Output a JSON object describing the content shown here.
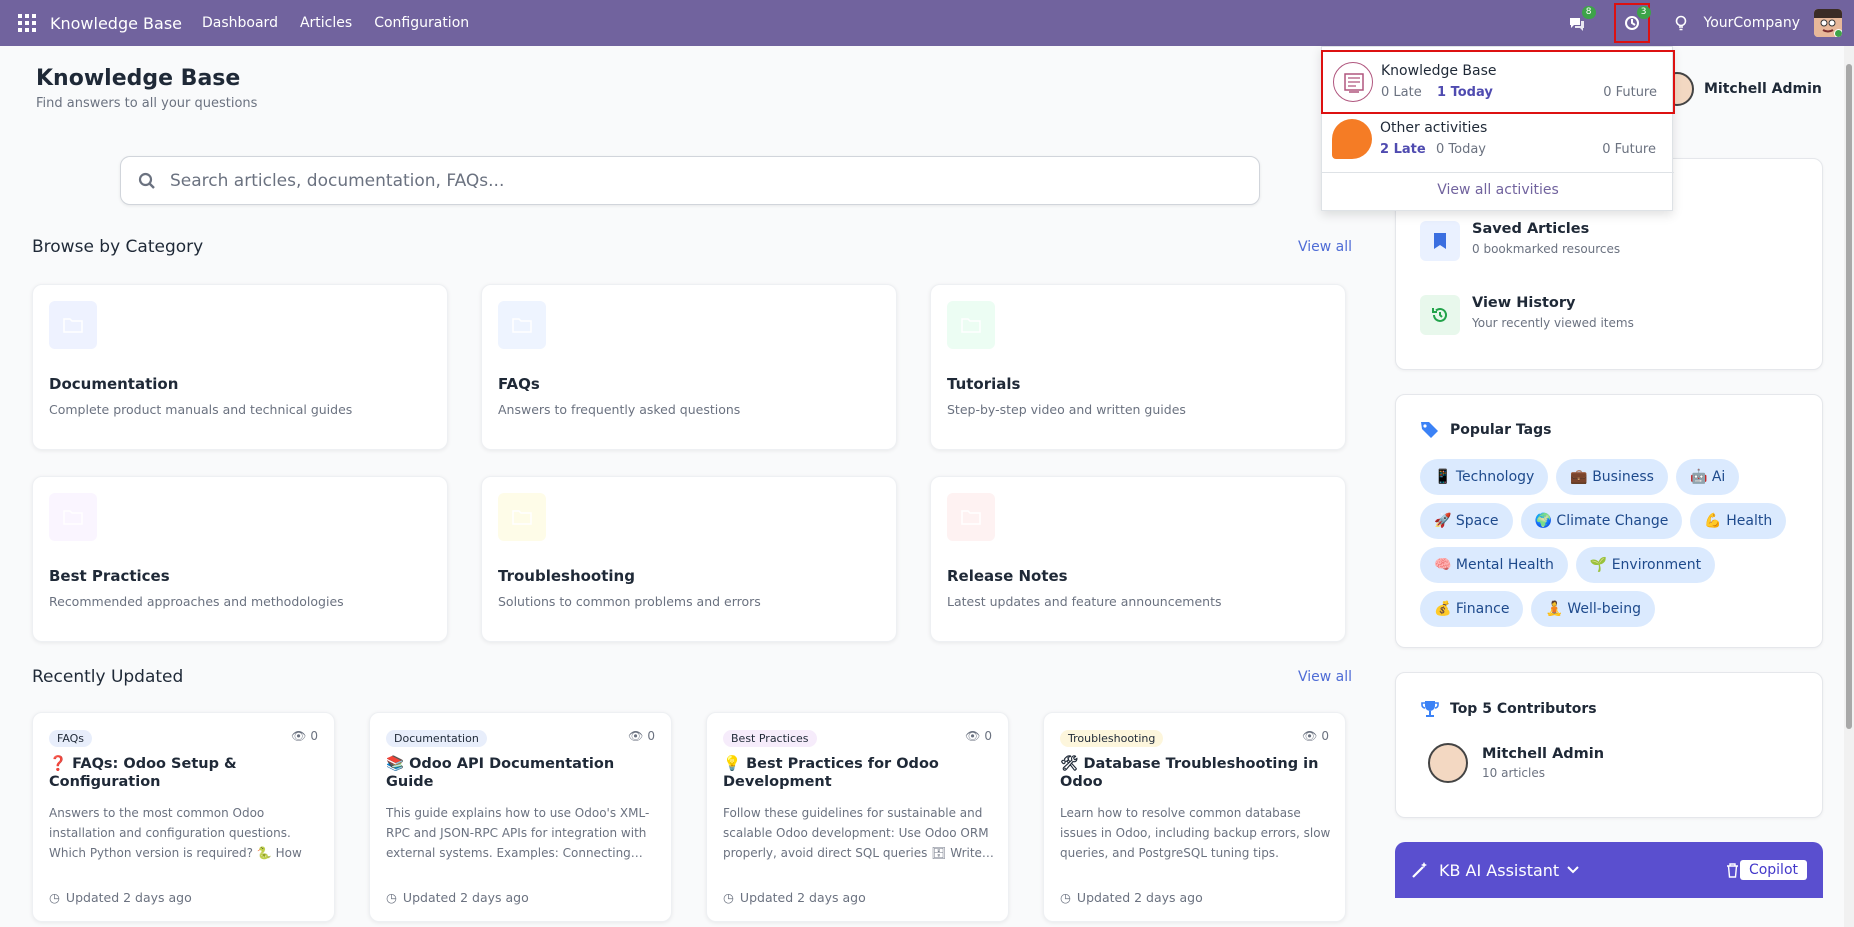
{
  "navbar": {
    "brand": "Knowledge Base",
    "menu": [
      "Dashboard",
      "Articles",
      "Configuration"
    ],
    "chat_badge": "8",
    "activity_badge": "3",
    "company": "YourCompany"
  },
  "header": {
    "title": "Knowledge Base",
    "subtitle": "Find answers to all your questions",
    "user_name": "Mitchell Admin"
  },
  "search": {
    "placeholder": "Search articles, documentation, FAQs..."
  },
  "categories": {
    "title": "Browse by Category",
    "view_all": "View all",
    "items": [
      {
        "name": "Documentation",
        "desc": "Complete product manuals and technical guides",
        "color": "#eef2ff"
      },
      {
        "name": "FAQs",
        "desc": "Answers to frequently asked questions",
        "color": "#eef4ff"
      },
      {
        "name": "Tutorials",
        "desc": "Step-by-step video and written guides",
        "color": "#ecfdf3"
      },
      {
        "name": "Best Practices",
        "desc": "Recommended approaches and methodologies",
        "color": "#faf5ff"
      },
      {
        "name": "Troubleshooting",
        "desc": "Solutions to common problems and errors",
        "color": "#fefce8"
      },
      {
        "name": "Release Notes",
        "desc": "Latest updates and feature announcements",
        "color": "#fef2f2"
      }
    ]
  },
  "recent": {
    "title": "Recently Updated",
    "view_all": "View all",
    "items": [
      {
        "tag": "FAQs",
        "tag_color": "#e8eefb",
        "views": "0",
        "title": "❓ FAQs: Odoo Setup & Configuration",
        "excerpt": "Answers to the most common Odoo installation and configuration questions. Which Python version is required? 🐍 How t…",
        "updated": "Updated 2 days ago"
      },
      {
        "tag": "Documentation",
        "tag_color": "#e8eefb",
        "views": "0",
        "title": "📚 Odoo API Documentation Guide",
        "excerpt": "This guide explains how to use Odoo's XML-RPC and JSON-RPC APIs for integration with external systems. Examples: Connecting… Python scripts with Odoo 🐍 Fetching product",
        "updated": "Updated 2 days ago"
      },
      {
        "tag": "Best Practices",
        "tag_color": "#f6ecfb",
        "views": "0",
        "title": "💡 Best Practices for Odoo Development",
        "excerpt": "Follow these guidelines for sustainable and scalable Odoo development: Use Odoo ORM properly, avoid direct SQL queries 🗄 Write…",
        "updated": "Updated 2 days ago"
      },
      {
        "tag": "Troubleshooting",
        "tag_color": "#fdf6dc",
        "views": "0",
        "title": "🛠 Database Troubleshooting in Odoo",
        "excerpt": "Learn how to resolve common database issues in Odoo, including backup errors, slow queries, and PostgreSQL tuning tips. Check…",
        "updated": "Updated 2 days ago"
      }
    ]
  },
  "quick": {
    "saved_title": "Saved Articles",
    "saved_sub": "0 bookmarked resources",
    "history_title": "View History",
    "history_sub": "Your recently viewed items"
  },
  "tags": {
    "title": "Popular Tags",
    "items": [
      "📱 Technology",
      "💼 Business",
      "🤖 Ai",
      "🚀 Space",
      "🌍 Climate Change",
      "💪 Health",
      "🧠 Mental Health",
      "🌱 Environment",
      "💰 Finance",
      "🧘 Well-being"
    ]
  },
  "contributors": {
    "title": "Top 5 Contributors",
    "name": "Mitchell Admin",
    "count": "10 articles"
  },
  "ai": {
    "label": "KB AI Assistant",
    "copilot": "Copilot"
  },
  "activities": {
    "kb": {
      "name": "Knowledge Base",
      "late": "0 Late",
      "today": "1 Today",
      "future": "0 Future"
    },
    "other": {
      "name": "Other activities",
      "late": "2 Late",
      "today": "0 Today",
      "future": "0 Future"
    },
    "view_all": "View all activities"
  }
}
